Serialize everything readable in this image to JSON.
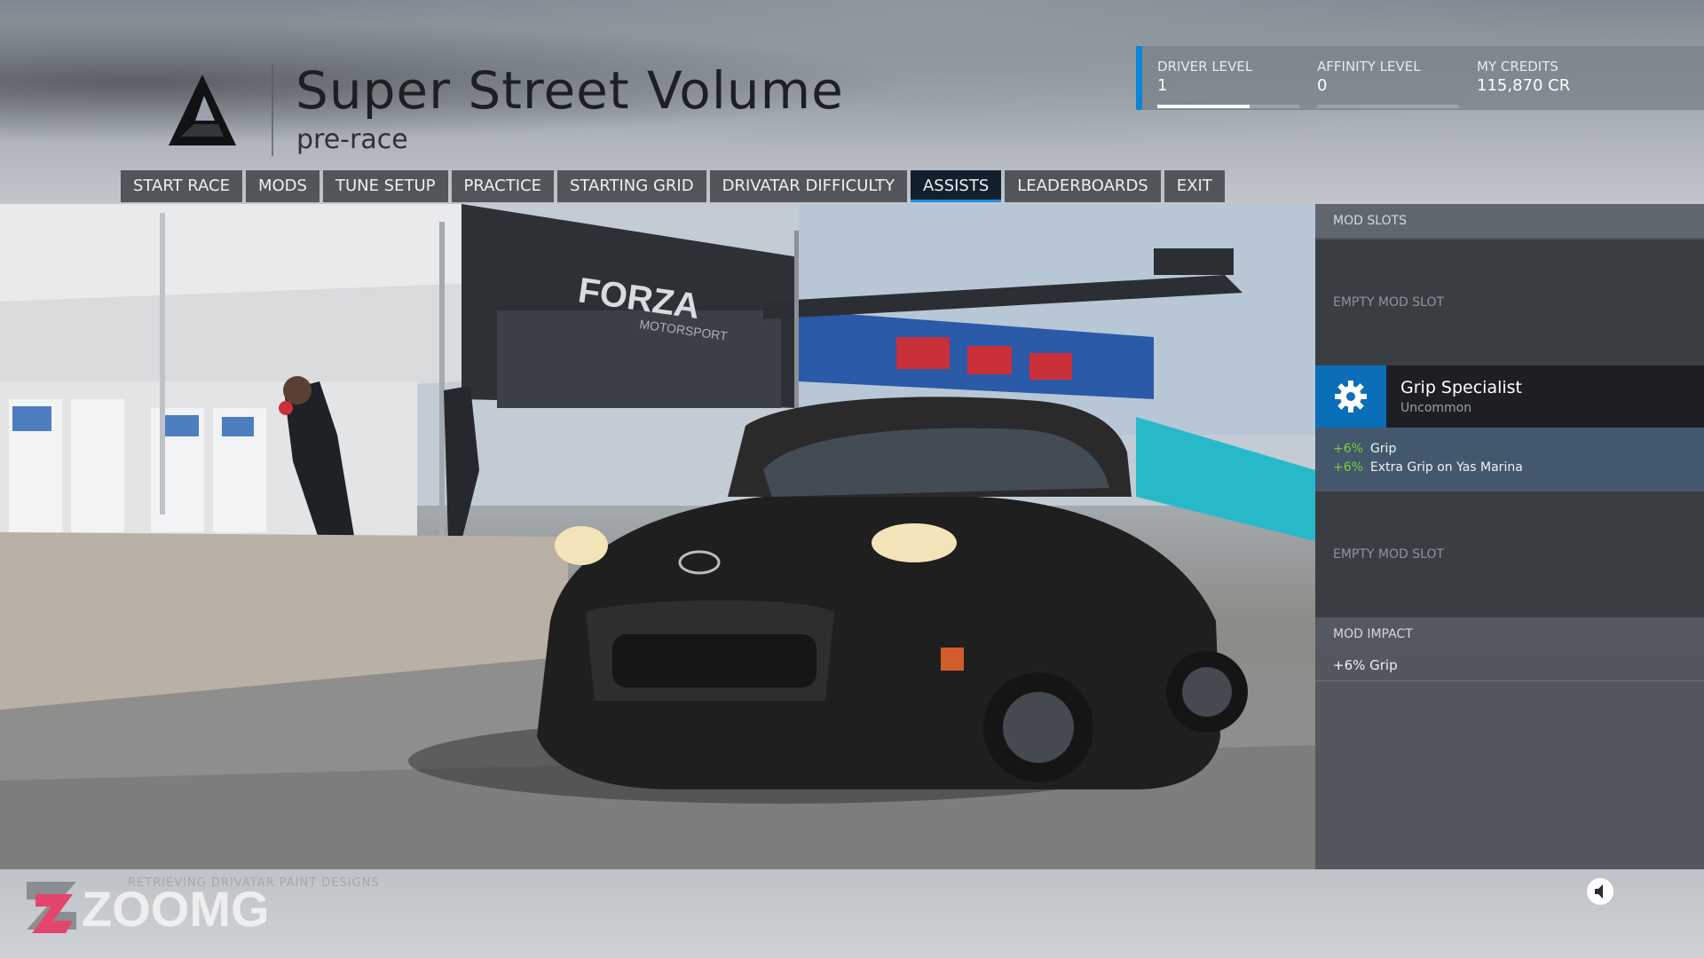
{
  "header": {
    "title": "Super Street Volume",
    "subtitle": "pre-race"
  },
  "stats": {
    "driver_level": {
      "label": "DRIVER LEVEL",
      "value": "1",
      "progress": 0.65
    },
    "affinity_level": {
      "label": "AFFINITY LEVEL",
      "value": "0",
      "progress": 0.0
    },
    "credits": {
      "label": "MY CREDITS",
      "value": "115,870 CR"
    }
  },
  "tabs": [
    {
      "label": "START RACE"
    },
    {
      "label": "MODS"
    },
    {
      "label": "TUNE SETUP"
    },
    {
      "label": "PRACTICE"
    },
    {
      "label": "STARTING GRID"
    },
    {
      "label": "DRIVATAR DIFFICULTY"
    },
    {
      "label": "ASSISTS",
      "active": true
    },
    {
      "label": "LEADERBOARDS"
    },
    {
      "label": "EXIT"
    }
  ],
  "mod_panel": {
    "slots_header": "MOD SLOTS",
    "empty_slot_1": "EMPTY MOD SLOT",
    "mod": {
      "name": "Grip Specialist",
      "rarity": "Uncommon",
      "icon": "gear-icon",
      "effects": [
        {
          "pct": "+6%",
          "text": "Grip"
        },
        {
          "pct": "+6%",
          "text": "Extra Grip on Yas Marina"
        }
      ]
    },
    "empty_slot_2": "EMPTY MOD SLOT",
    "impact_header": "MOD IMPACT",
    "impact_value": "+6% Grip"
  },
  "footer": {
    "status": "RETRIEVING DRIVATAR PAINT DESIGNS",
    "watermark": "ZOOMG"
  },
  "scene": {
    "banner_text": "FORZA",
    "banner_subtext": "MOTORSPORT"
  },
  "colors": {
    "accent": "#1f8fe0",
    "mod_icon_bg": "#0a6fb8",
    "effect_green": "#7fcc3a"
  }
}
